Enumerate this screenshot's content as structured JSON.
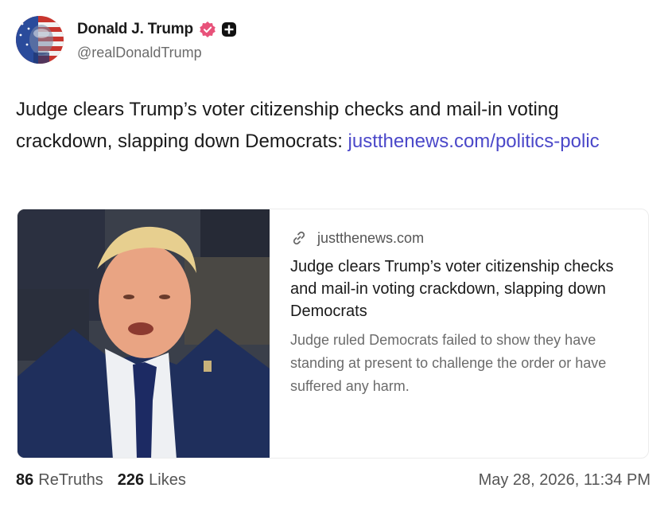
{
  "author": {
    "display_name": "Donald J. Trump",
    "handle": "@realDonaldTrump",
    "verified_color": "#e8527a",
    "icons": [
      "avatar-flag-portrait",
      "verified-badge-icon",
      "plus-badge-icon"
    ]
  },
  "post": {
    "text": "Judge clears Trump’s voter citizenship checks and mail-in voting crackdown, slapping down Democrats: ",
    "link_text": "justthenews.com/politics-polic",
    "link_color": "#4b48c9"
  },
  "link_card": {
    "domain": "justthenews.com",
    "title": "Judge clears Trump’s voter citizenship checks and mail-in voting crackdown, slapping down Democrats",
    "description": "Judge ruled Democrats failed to show they have standing at present to challenge the order or have suffered any harm.",
    "icon": "link-icon"
  },
  "footer": {
    "retruths_count": "86",
    "retruths_label": "ReTruths",
    "likes_count": "226",
    "likes_label": "Likes",
    "timestamp": "May 28, 2026, 11:34 PM"
  }
}
